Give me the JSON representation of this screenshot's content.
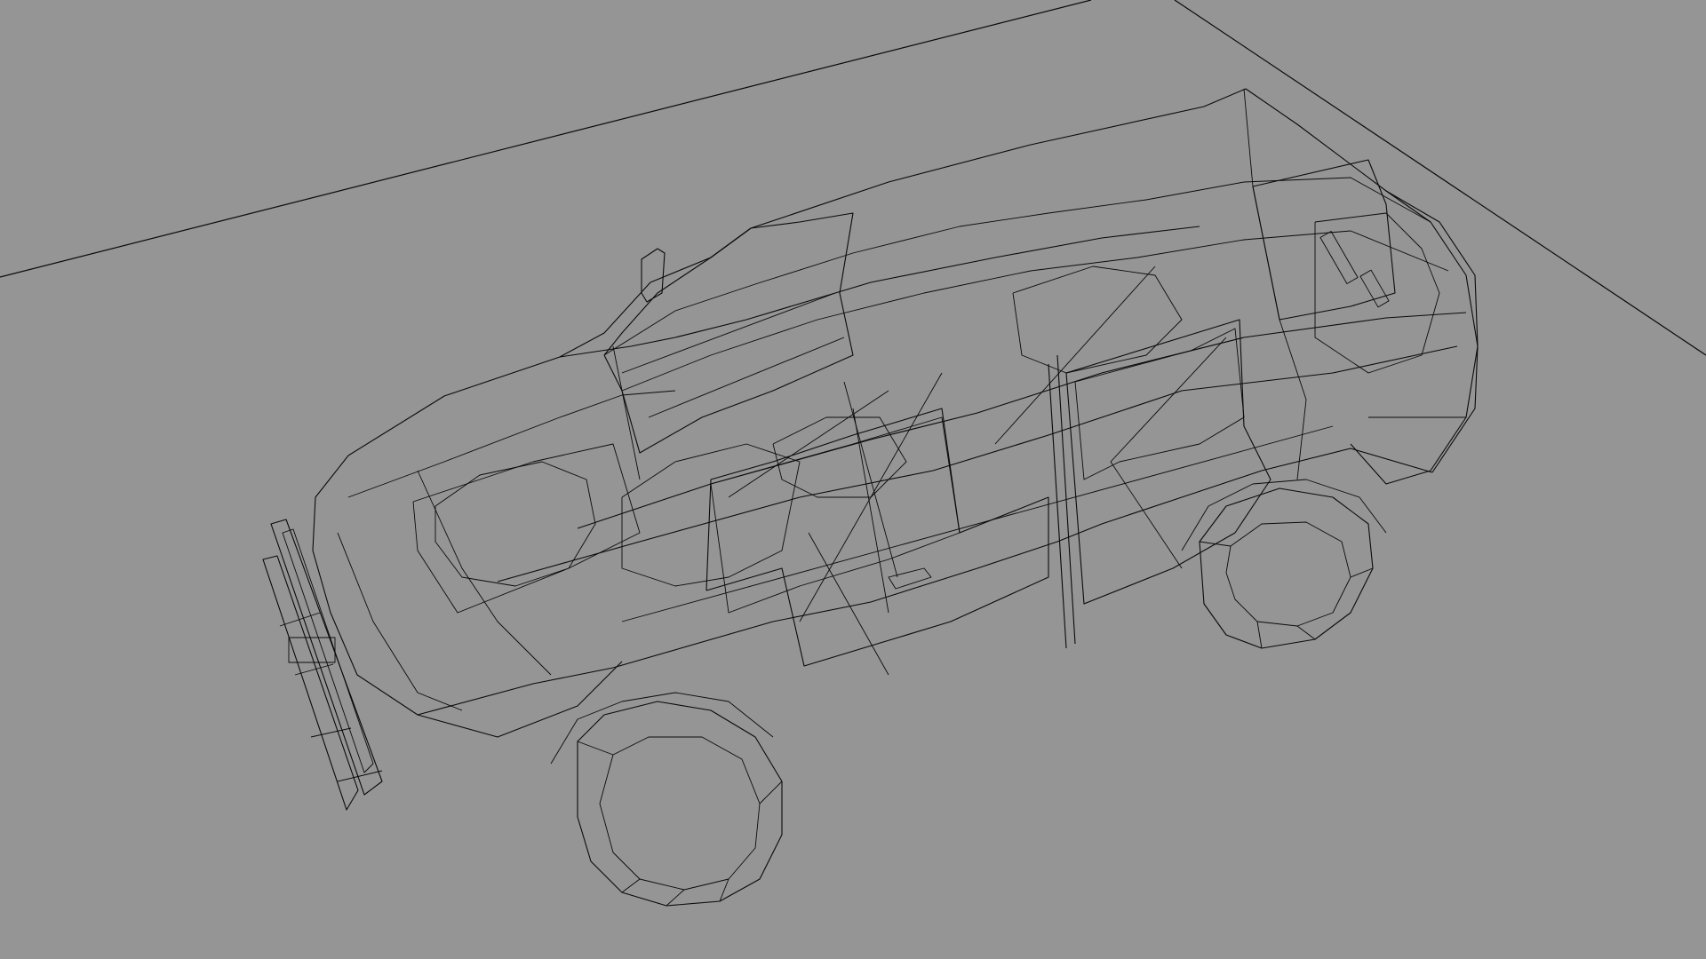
{
  "viewport": {
    "background": "#959595",
    "line_color": "#0a0a0a",
    "render_mode": "wireframe"
  },
  "scene": {
    "object": "vehicle-wireframe-model",
    "has_ground_plane_edges": true
  }
}
